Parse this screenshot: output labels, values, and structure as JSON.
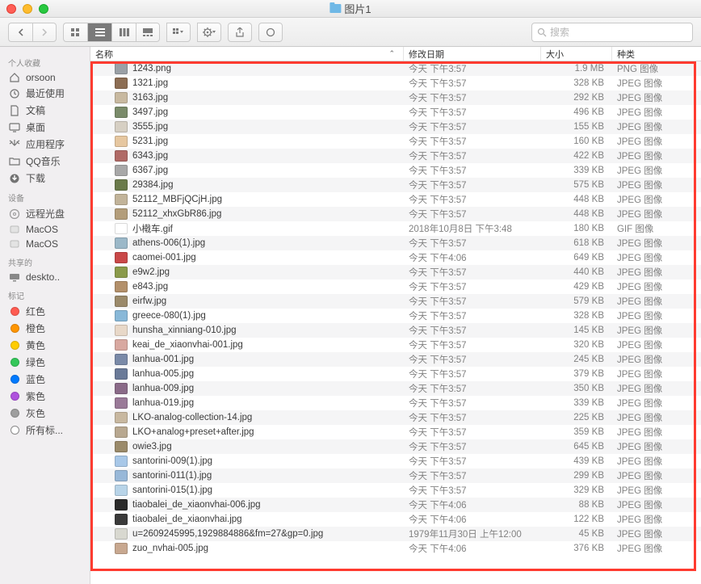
{
  "window": {
    "title": "图片1"
  },
  "toolbar": {
    "search_placeholder": "搜索"
  },
  "columns": {
    "name": "名称",
    "date": "修改日期",
    "size": "大小",
    "kind": "种类"
  },
  "sidebar": {
    "sections": [
      {
        "title": "个人收藏",
        "items": [
          {
            "label": "orsoon",
            "icon": "home"
          },
          {
            "label": "最近使用",
            "icon": "clock"
          },
          {
            "label": "文稿",
            "icon": "doc"
          },
          {
            "label": "桌面",
            "icon": "desktop"
          },
          {
            "label": "应用程序",
            "icon": "app"
          },
          {
            "label": "QQ音乐",
            "icon": "folder"
          },
          {
            "label": "下载",
            "icon": "download"
          }
        ]
      },
      {
        "title": "设备",
        "items": [
          {
            "label": "远程光盘",
            "icon": "disc"
          },
          {
            "label": "MacOS",
            "icon": "disk"
          },
          {
            "label": "MacOS",
            "icon": "disk"
          }
        ]
      },
      {
        "title": "共享的",
        "items": [
          {
            "label": "deskto..",
            "icon": "computer"
          }
        ]
      },
      {
        "title": "标记",
        "items": [
          {
            "label": "红色",
            "color": "#ff5b51"
          },
          {
            "label": "橙色",
            "color": "#ff9500"
          },
          {
            "label": "黄色",
            "color": "#ffcc00"
          },
          {
            "label": "绿色",
            "color": "#34c759"
          },
          {
            "label": "蓝色",
            "color": "#007aff"
          },
          {
            "label": "紫色",
            "color": "#af52de"
          },
          {
            "label": "灰色",
            "color": "#9e9e9e"
          },
          {
            "label": "所有标...",
            "color": null,
            "all": true
          }
        ]
      }
    ]
  },
  "files": [
    {
      "name": "1243.png",
      "date": "今天 下午3:57",
      "size": "1.9 MB",
      "kind": "PNG 图像",
      "thumb": "#9aa0a6"
    },
    {
      "name": "1321.jpg",
      "date": "今天 下午3:57",
      "size": "328 KB",
      "kind": "JPEG 图像",
      "thumb": "#8c6d53"
    },
    {
      "name": "3163.jpg",
      "date": "今天 下午3:57",
      "size": "292 KB",
      "kind": "JPEG 图像",
      "thumb": "#c8b9a0"
    },
    {
      "name": "3497.jpg",
      "date": "今天 下午3:57",
      "size": "496 KB",
      "kind": "JPEG 图像",
      "thumb": "#7a8b6a"
    },
    {
      "name": "3555.jpg",
      "date": "今天 下午3:57",
      "size": "155 KB",
      "kind": "JPEG 图像",
      "thumb": "#d6cfc3"
    },
    {
      "name": "5231.jpg",
      "date": "今天 下午3:57",
      "size": "160 KB",
      "kind": "JPEG 图像",
      "thumb": "#e6c7a0"
    },
    {
      "name": "6343.jpg",
      "date": "今天 下午3:57",
      "size": "422 KB",
      "kind": "JPEG 图像",
      "thumb": "#b06a66"
    },
    {
      "name": "6367.jpg",
      "date": "今天 下午3:57",
      "size": "339 KB",
      "kind": "JPEG 图像",
      "thumb": "#a8a8a8"
    },
    {
      "name": "29384.jpg",
      "date": "今天 下午3:57",
      "size": "575 KB",
      "kind": "JPEG 图像",
      "thumb": "#6a7a4a"
    },
    {
      "name": "52112_MBFjQCjH.jpg",
      "date": "今天 下午3:57",
      "size": "448 KB",
      "kind": "JPEG 图像",
      "thumb": "#c2b49a"
    },
    {
      "name": "52112_xhxGbR86.jpg",
      "date": "今天 下午3:57",
      "size": "448 KB",
      "kind": "JPEG 图像",
      "thumb": "#b39d7a"
    },
    {
      "name": "小橶车.gif",
      "date": "2018年10月8日 下午3:48",
      "size": "180 KB",
      "kind": "GIF 图像",
      "thumb": "#ffffff"
    },
    {
      "name": "athens-006(1).jpg",
      "date": "今天 下午3:57",
      "size": "618 KB",
      "kind": "JPEG 图像",
      "thumb": "#9bb8c8"
    },
    {
      "name": "caomei-001.jpg",
      "date": "今天 下午4:06",
      "size": "649 KB",
      "kind": "JPEG 图像",
      "thumb": "#c94848"
    },
    {
      "name": "e9w2.jpg",
      "date": "今天 下午3:57",
      "size": "440 KB",
      "kind": "JPEG 图像",
      "thumb": "#8a9a4a"
    },
    {
      "name": "e843.jpg",
      "date": "今天 下午3:57",
      "size": "429 KB",
      "kind": "JPEG 图像",
      "thumb": "#b3906a"
    },
    {
      "name": "eirfw.jpg",
      "date": "今天 下午3:57",
      "size": "579 KB",
      "kind": "JPEG 图像",
      "thumb": "#9b8a6a"
    },
    {
      "name": "greece-080(1).jpg",
      "date": "今天 下午3:57",
      "size": "328 KB",
      "kind": "JPEG 图像",
      "thumb": "#88b8d8"
    },
    {
      "name": "hunsha_xinniang-010.jpg",
      "date": "今天 下午3:57",
      "size": "145 KB",
      "kind": "JPEG 图像",
      "thumb": "#e8d8c8"
    },
    {
      "name": "keai_de_xiaonvhai-001.jpg",
      "date": "今天 下午3:57",
      "size": "320 KB",
      "kind": "JPEG 图像",
      "thumb": "#d8a8a0"
    },
    {
      "name": "lanhua-001.jpg",
      "date": "今天 下午3:57",
      "size": "245 KB",
      "kind": "JPEG 图像",
      "thumb": "#7a8aa8"
    },
    {
      "name": "lanhua-005.jpg",
      "date": "今天 下午3:57",
      "size": "379 KB",
      "kind": "JPEG 图像",
      "thumb": "#6a7a98"
    },
    {
      "name": "lanhua-009.jpg",
      "date": "今天 下午3:57",
      "size": "350 KB",
      "kind": "JPEG 图像",
      "thumb": "#8a6a88"
    },
    {
      "name": "lanhua-019.jpg",
      "date": "今天 下午3:57",
      "size": "339 KB",
      "kind": "JPEG 图像",
      "thumb": "#9a7a98"
    },
    {
      "name": "LKO-analog-collection-14.jpg",
      "date": "今天 下午3:57",
      "size": "225 KB",
      "kind": "JPEG 图像",
      "thumb": "#c8b8a0"
    },
    {
      "name": "LKO+analog+preset+after.jpg",
      "date": "今天 下午3:57",
      "size": "359 KB",
      "kind": "JPEG 图像",
      "thumb": "#b8a890"
    },
    {
      "name": "owie3.jpg",
      "date": "今天 下午3:57",
      "size": "645 KB",
      "kind": "JPEG 图像",
      "thumb": "#9a8a6a"
    },
    {
      "name": "santorini-009(1).jpg",
      "date": "今天 下午3:57",
      "size": "439 KB",
      "kind": "JPEG 图像",
      "thumb": "#a8c8e8"
    },
    {
      "name": "santorini-011(1).jpg",
      "date": "今天 下午3:57",
      "size": "299 KB",
      "kind": "JPEG 图像",
      "thumb": "#98b8d8"
    },
    {
      "name": "santorini-015(1).jpg",
      "date": "今天 下午3:57",
      "size": "329 KB",
      "kind": "JPEG 图像",
      "thumb": "#b8d4e8"
    },
    {
      "name": "tiaobalei_de_xiaonvhai-006.jpg",
      "date": "今天 下午4:06",
      "size": "88 KB",
      "kind": "JPEG 图像",
      "thumb": "#2a2a2a"
    },
    {
      "name": "tiaobalei_de_xiaonvhai.jpg",
      "date": "今天 下午4:06",
      "size": "122 KB",
      "kind": "JPEG 图像",
      "thumb": "#3a3a3a"
    },
    {
      "name": "u=2609245995,1929884886&fm=27&gp=0.jpg",
      "date": "1979年11月30日 上午12:00",
      "size": "45 KB",
      "kind": "JPEG 图像",
      "thumb": "#d8d8d0"
    },
    {
      "name": "zuo_nvhai-005.jpg",
      "date": "今天 下午4:06",
      "size": "376 KB",
      "kind": "JPEG 图像",
      "thumb": "#c8a890"
    }
  ]
}
